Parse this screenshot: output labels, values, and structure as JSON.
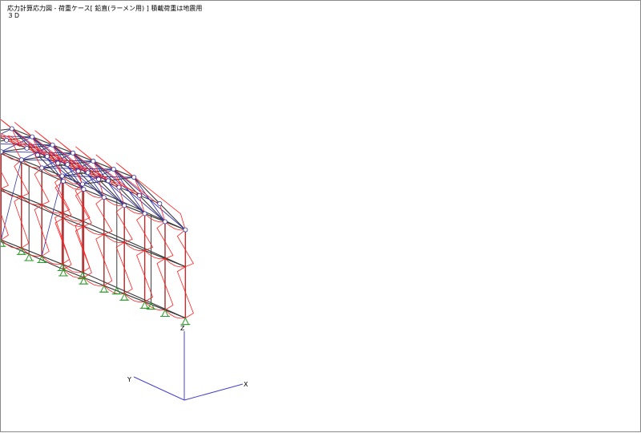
{
  "header": {
    "title": "応力計算応力図 - 荷重ケース[ 鉛直(ラーメン用) ] 積載荷重は地震用",
    "view": "３Ｄ"
  },
  "axes": {
    "x": "X",
    "y": "Y",
    "z": "Z"
  },
  "colors": {
    "frame": "#3a3a3a",
    "moment": "#ff1f1f",
    "brace": "#3333aa",
    "support": "#2a9a2a",
    "axis": "#4444cc"
  }
}
